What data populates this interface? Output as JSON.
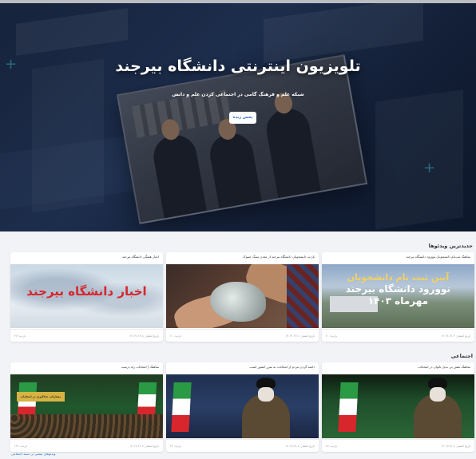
{
  "hero": {
    "title": "تلویزیون اینترنتی دانشگاه بیرجند",
    "subtitle": "شبکه علم و فرهنگ گامی در اجتماعی کردن علم و دانش",
    "live_button": "پخش زنده"
  },
  "sections": [
    {
      "title": "جدیدترین ویدئوها",
      "cards": [
        {
          "title": "نماهنگ ثبت‌نام دانشجویان نوورود دانشگاه بیرجند",
          "thumb_text": [
            "آیین ثبت نام دانشجویان",
            "نوورود دانشگاه بیرجند",
            "مهرماه ۱۴۰۳"
          ],
          "date": "تاریخ انتشار: ۱۴۰۳/۰۷/۰۳",
          "views": "بازدید: ۳۰"
        },
        {
          "title": "بازدید دانشجویان دانشگاه بیرجند از معدن سنگ چینوک",
          "thumb_text": [],
          "date": "تاریخ انتشار: ۱۴۰۳/۰۲/۱۱",
          "views": "بازدید: ۲۰"
        },
        {
          "title": "اخبار هفتگی دانشگاه بیرجند",
          "thumb_text": [
            "اخبار دانشگاه بیرجند"
          ],
          "date": "تاریخ انتشار: ۱۴۰۳/۰۲/۱۸",
          "views": "بازدید: ۴۷"
        }
      ]
    },
    {
      "title": "اجتماعی",
      "cards": [
        {
          "title": "نماهنگ نقش بی بدیل بانوان در انتخابات",
          "date": "تاریخ انتشار: ۱۴۰۲/۱۲/۰۷",
          "views": "بازدید: ۶۷"
        },
        {
          "title": "دامنه گردن مردم از انتخابات به ضرر کشور است.",
          "date": "تاریخ انتشار: ۱۴۰۲/۱۲/۰۷",
          "views": "بازدید: ۲۳"
        },
        {
          "title": "نماهنگ | انتخابات راه درست",
          "banner": "مشارکت حداکثری در انتخابات",
          "date": "تاریخ انتشار: ۱۴۰۲/۱۲/۰۷",
          "views": "بازدید: ۲۲۴"
        }
      ]
    }
  ],
  "footer": {
    "link_text": "ویدئوهای بیشتر در دسته اجتماعی"
  },
  "colors": {
    "accent": "#2a6fd6",
    "news_red": "#d7262c",
    "page_bg": "#f1f3f6"
  },
  "icons": [
    "play-icon"
  ]
}
